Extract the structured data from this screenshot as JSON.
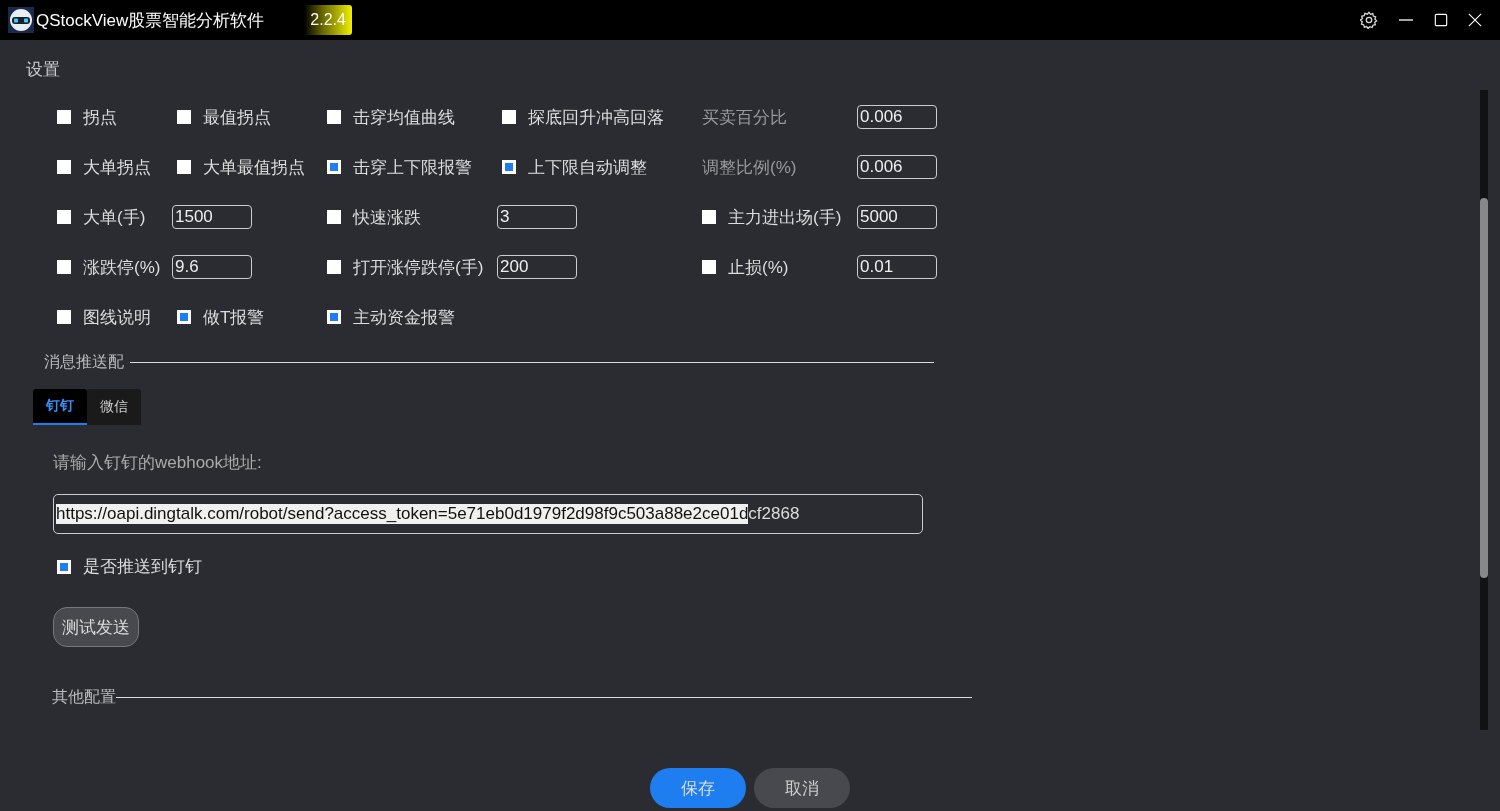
{
  "window": {
    "title": "QStockView股票智能分析软件",
    "version": "2.2.4"
  },
  "page_title": "设置",
  "alert_rows": [
    [
      {
        "kind": "checkbox",
        "label": "拐点",
        "checked": false
      },
      {
        "kind": "checkbox",
        "label": "最值拐点",
        "checked": false
      },
      {
        "kind": "checkbox",
        "label": "击穿均值曲线",
        "checked": false
      },
      {
        "kind": "checkbox",
        "label": "探底回升冲高回落",
        "checked": false
      },
      {
        "kind": "label",
        "label": "买卖百分比"
      },
      {
        "kind": "field",
        "value": "0.006"
      }
    ],
    [
      {
        "kind": "checkbox",
        "label": "大单拐点",
        "checked": false
      },
      {
        "kind": "checkbox",
        "label": "大单最值拐点",
        "checked": false
      },
      {
        "kind": "checkbox",
        "label": "击穿上下限报警",
        "checked": true
      },
      {
        "kind": "checkbox",
        "label": "上下限自动调整",
        "checked": true
      },
      {
        "kind": "label",
        "label": "调整比例(%)"
      },
      {
        "kind": "field",
        "value": "0.006"
      }
    ],
    [
      {
        "kind": "checkbox",
        "label": "大单(手)",
        "checked": false
      },
      {
        "kind": "field",
        "value": "1500"
      },
      {
        "kind": "checkbox",
        "label": "快速涨跌",
        "checked": false
      },
      {
        "kind": "field",
        "value": "3"
      },
      {
        "kind": "checkbox",
        "label": "主力进出场(手)",
        "checked": false
      },
      {
        "kind": "field",
        "value": "5000"
      }
    ],
    [
      {
        "kind": "checkbox",
        "label": "涨跌停(%)",
        "checked": false
      },
      {
        "kind": "field",
        "value": "9.6"
      },
      {
        "kind": "checkbox",
        "label": "打开涨停跌停(手)",
        "checked": false
      },
      {
        "kind": "field",
        "value": "200"
      },
      {
        "kind": "checkbox",
        "label": "止损(%)",
        "checked": false
      },
      {
        "kind": "field",
        "value": "0.01"
      }
    ],
    [
      {
        "kind": "checkbox",
        "label": "图线说明",
        "checked": false
      },
      {
        "kind": "checkbox",
        "label": "做T报警",
        "checked": true
      },
      {
        "kind": "checkbox",
        "label": "主动资金报警",
        "checked": true
      }
    ]
  ],
  "push_section": {
    "title": "消息推送配",
    "tabs": [
      {
        "label": "钉钉",
        "selected": true
      },
      {
        "label": "微信",
        "selected": false
      }
    ],
    "webhook_label": "请输入钉钉的webhook地址:",
    "webhook_value": [
      {
        "text": "https://oapi.dingtalk.com/robot/send?access_token=5e71eb0d1979f2d98f9c503a88e2ce01d",
        "selected": true
      },
      {
        "text": "cf2868",
        "selected": false
      }
    ],
    "push_checkbox": {
      "label": "是否推送到钉钉",
      "checked": true
    },
    "test_button": "测试发送"
  },
  "other_section": {
    "title": "其他配置"
  },
  "buttons": [
    {
      "label": "保存",
      "kind": "primary"
    },
    {
      "label": "取消",
      "kind": "secondary"
    }
  ]
}
